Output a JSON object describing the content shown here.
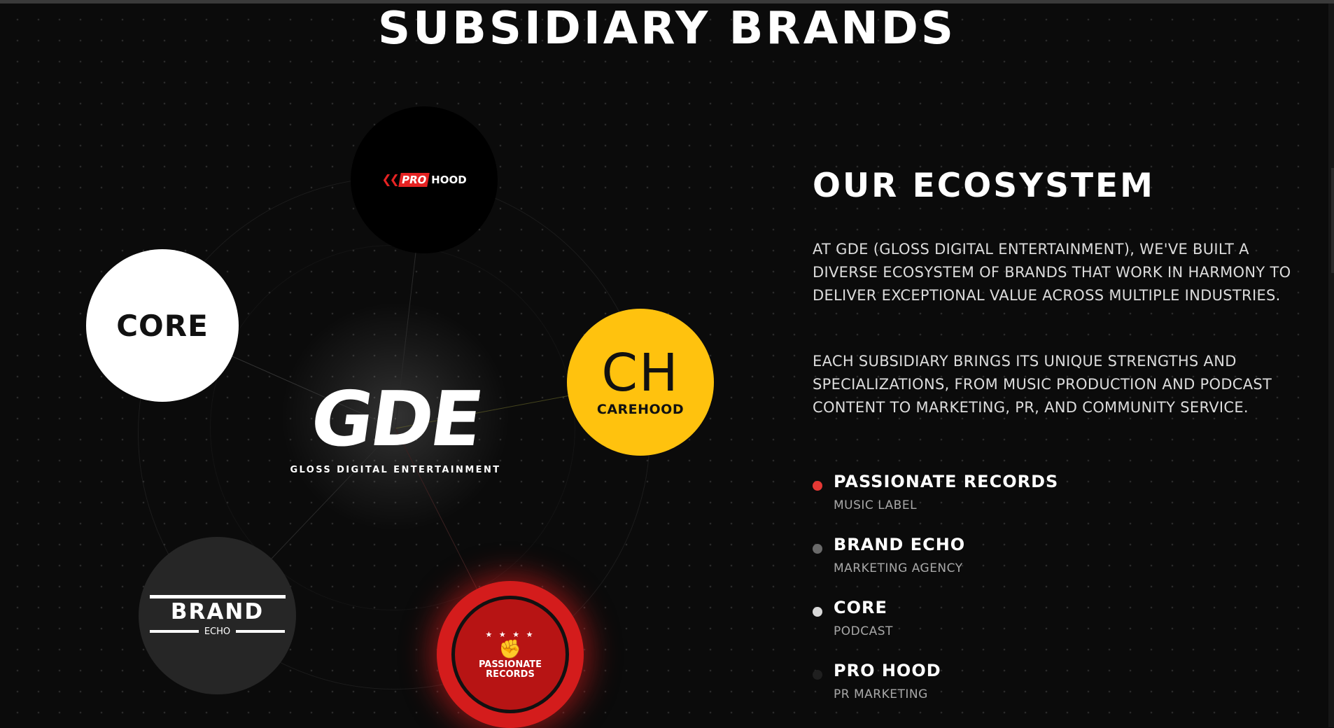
{
  "section": {
    "title": "SUBSIDIARY BRANDS"
  },
  "center": {
    "mark": "GDE",
    "tagline": "GLOSS DIGITAL ENTERTAINMENT"
  },
  "bubbles": {
    "prohood": {
      "pro": "PRO",
      "hood": "HOOD"
    },
    "core": {
      "text": "CORE"
    },
    "carehood": {
      "mark": "CH",
      "name": "CAREHOOD"
    },
    "brand_echo": {
      "name": "BRAND",
      "sub": "ECHO"
    },
    "passionate": {
      "stars": "★ ★ ★ ★",
      "name": "PASSIONATE RECORDS"
    }
  },
  "ecosystem": {
    "title": "OUR ECOSYSTEM",
    "paragraph_1": "AT GDE (GLOSS DIGITAL ENTERTAINMENT), WE'VE BUILT A DIVERSE ECOSYSTEM OF BRANDS THAT WORK IN HARMONY TO DELIVER EXCEPTIONAL VALUE ACROSS MULTIPLE INDUSTRIES.",
    "paragraph_2": "EACH SUBSIDIARY BRINGS ITS UNIQUE STRENGTHS AND SPECIALIZATIONS, FROM MUSIC PRODUCTION AND PODCAST CONTENT TO MARKETING, PR, AND COMMUNITY SERVICE.",
    "brands": [
      {
        "name": "PASSIONATE RECORDS",
        "type": "MUSIC LABEL",
        "dot_color": "#e53935"
      },
      {
        "name": "BRAND ECHO",
        "type": "MARKETING AGENCY",
        "dot_color": "#6a6a6a"
      },
      {
        "name": "CORE",
        "type": "PODCAST",
        "dot_color": "#d8d8d8"
      },
      {
        "name": "PRO HOOD",
        "type": "PR MARKETING",
        "dot_color": "#1f1f1f"
      }
    ]
  },
  "colors": {
    "background": "#0b0b0b",
    "carehood_yellow": "#ffc20e",
    "passionate_red": "#d41c1c",
    "prohood_red": "#e52323"
  }
}
